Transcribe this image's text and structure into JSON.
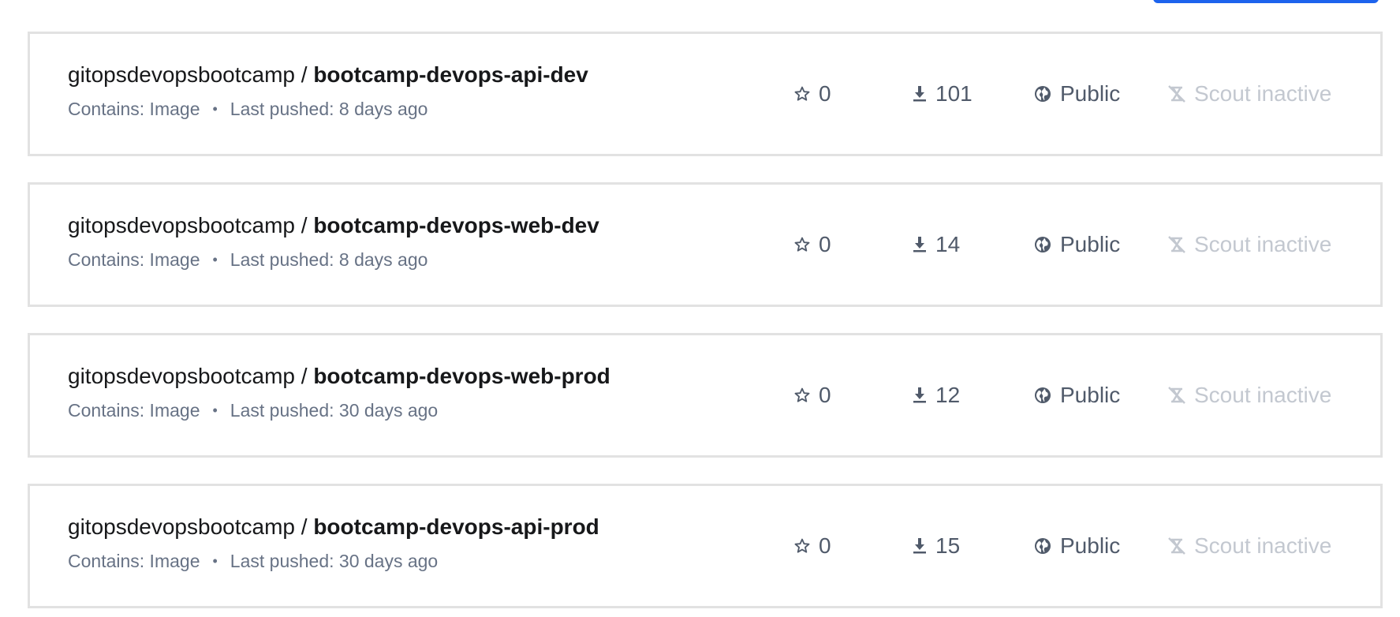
{
  "repositories": [
    {
      "namespace": "gitopsdevopsbootcamp",
      "separator": " / ",
      "name": "bootcamp-devops-api-dev",
      "contains": "Contains: Image",
      "bullet": "•",
      "last_pushed": "Last pushed: 8 days ago",
      "stars": "0",
      "pulls": "101",
      "visibility": "Public",
      "scout": "Scout inactive"
    },
    {
      "namespace": "gitopsdevopsbootcamp",
      "separator": " / ",
      "name": "bootcamp-devops-web-dev",
      "contains": "Contains: Image",
      "bullet": "•",
      "last_pushed": "Last pushed: 8 days ago",
      "stars": "0",
      "pulls": "14",
      "visibility": "Public",
      "scout": "Scout inactive"
    },
    {
      "namespace": "gitopsdevopsbootcamp",
      "separator": " / ",
      "name": "bootcamp-devops-web-prod",
      "contains": "Contains: Image",
      "bullet": "•",
      "last_pushed": "Last pushed: 30 days ago",
      "stars": "0",
      "pulls": "12",
      "visibility": "Public",
      "scout": "Scout inactive"
    },
    {
      "namespace": "gitopsdevopsbootcamp",
      "separator": " / ",
      "name": "bootcamp-devops-api-prod",
      "contains": "Contains: Image",
      "bullet": "•",
      "last_pushed": "Last pushed: 30 days ago",
      "stars": "0",
      "pulls": "15",
      "visibility": "Public",
      "scout": "Scout inactive"
    }
  ],
  "icons": {
    "star": "star-outline-icon",
    "pulls": "download-icon",
    "visibility": "globe-icon",
    "scout": "scout-off-icon"
  },
  "colors": {
    "accent": "#1d63ed",
    "card_border": "#e2e2e2",
    "title_text": "#17181a",
    "meta_text": "#677285",
    "stat_text": "#505a6a",
    "inactive_text": "#c3c8d0"
  }
}
